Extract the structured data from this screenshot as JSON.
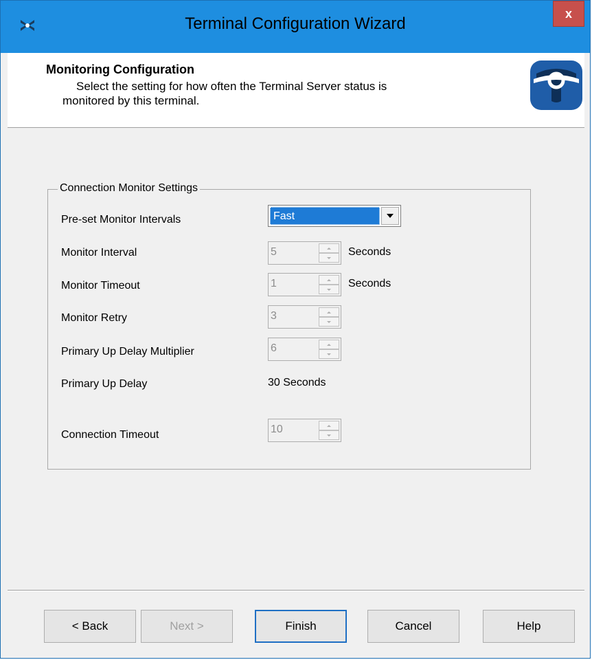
{
  "window": {
    "title": "Terminal Configuration Wizard",
    "close_label": "x"
  },
  "header": {
    "title": "Monitoring Configuration",
    "description_line1": "Select the setting for how often the Terminal Server status is",
    "description_line2": "monitored by this terminal."
  },
  "group": {
    "legend": "Connection Monitor Settings",
    "preset": {
      "label": "Pre-set Monitor Intervals",
      "selected": "Fast"
    },
    "monitor_interval": {
      "label": "Monitor Interval",
      "value": "5",
      "unit": "Seconds"
    },
    "monitor_timeout": {
      "label": "Monitor Timeout",
      "value": "1",
      "unit": "Seconds"
    },
    "monitor_retry": {
      "label": "Monitor Retry",
      "value": "3"
    },
    "primary_up_delay_multiplier": {
      "label": "Primary Up Delay Multiplier",
      "value": "6"
    },
    "primary_up_delay": {
      "label": "Primary Up Delay",
      "value": "30 Seconds"
    },
    "connection_timeout": {
      "label": "Connection Timeout",
      "value": "10"
    }
  },
  "buttons": {
    "back": "< Back",
    "next": "Next >",
    "finish": "Finish",
    "cancel": "Cancel",
    "help": "Help"
  },
  "colors": {
    "titlebar": "#1e8ee0",
    "close": "#c7504c",
    "selection": "#1e7bd6"
  }
}
